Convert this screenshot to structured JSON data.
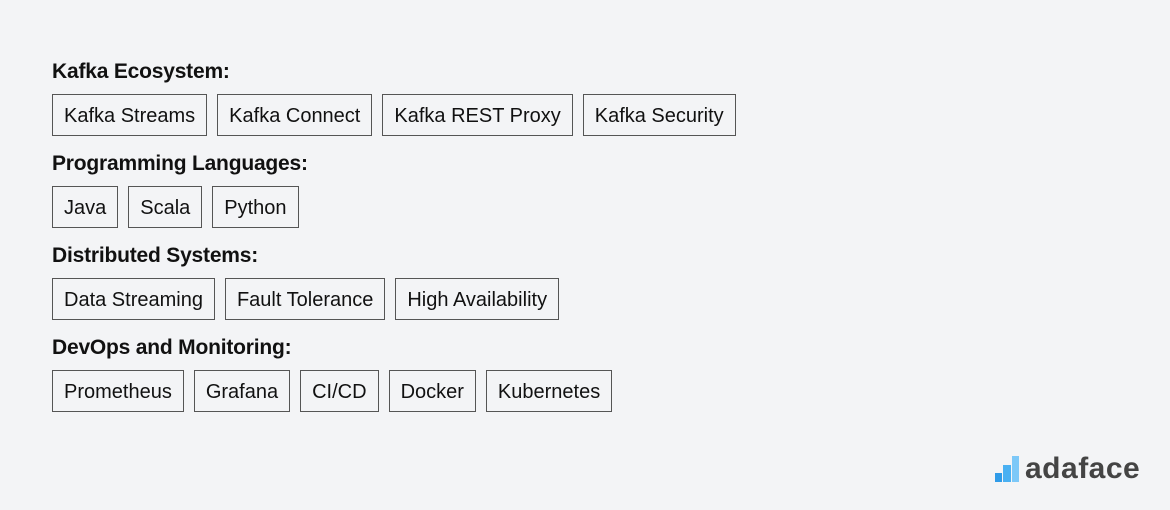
{
  "sections": [
    {
      "title": "Kafka Ecosystem:",
      "tags": [
        "Kafka Streams",
        "Kafka Connect",
        "Kafka REST Proxy",
        "Kafka Security"
      ]
    },
    {
      "title": "Programming Languages:",
      "tags": [
        "Java",
        "Scala",
        "Python"
      ]
    },
    {
      "title": "Distributed Systems:",
      "tags": [
        "Data Streaming",
        "Fault Tolerance",
        "High Availability"
      ]
    },
    {
      "title": "DevOps and Monitoring:",
      "tags": [
        "Prometheus",
        "Grafana",
        "CI/CD",
        "Docker",
        "Kubernetes"
      ]
    }
  ],
  "logo": {
    "icon": "bar-chart-logo-icon",
    "text": "adaface"
  }
}
